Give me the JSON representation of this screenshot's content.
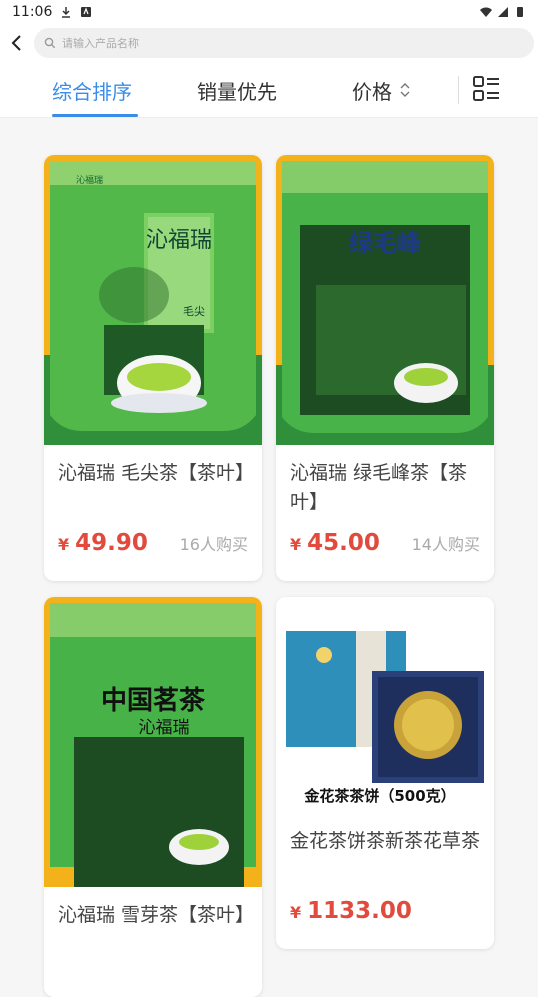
{
  "status": {
    "time": "11:06"
  },
  "search": {
    "placeholder": "请输入产品名称"
  },
  "sort": {
    "tabs": [
      {
        "label": "综合排序",
        "active": true
      },
      {
        "label": "销量优先",
        "active": false
      },
      {
        "label": "价格",
        "active": false
      }
    ]
  },
  "colors": {
    "accent": "#3b8ce8",
    "price": "#e14a3c"
  },
  "products": [
    {
      "title": "沁福瑞 毛尖茶【茶叶】",
      "currency": "¥",
      "price": "49.90",
      "sold": "16人购买",
      "package_brand": "沁福瑞",
      "package_name": "毛尖"
    },
    {
      "title": "沁福瑞 绿毛峰茶【茶叶】",
      "currency": "¥",
      "price": "45.00",
      "sold": "14人购买",
      "package_name": "绿毛峰"
    },
    {
      "title": "沁福瑞 雪芽茶【茶叶】",
      "currency": "¥",
      "price": "",
      "sold": "",
      "package_title": "中国茗茶",
      "package_brand": "沁福瑞"
    },
    {
      "title": "金花茶饼茶新茶花草茶",
      "currency": "¥",
      "price": "1133.00",
      "sold": "",
      "caption": "金花茶茶饼（500克）"
    }
  ]
}
